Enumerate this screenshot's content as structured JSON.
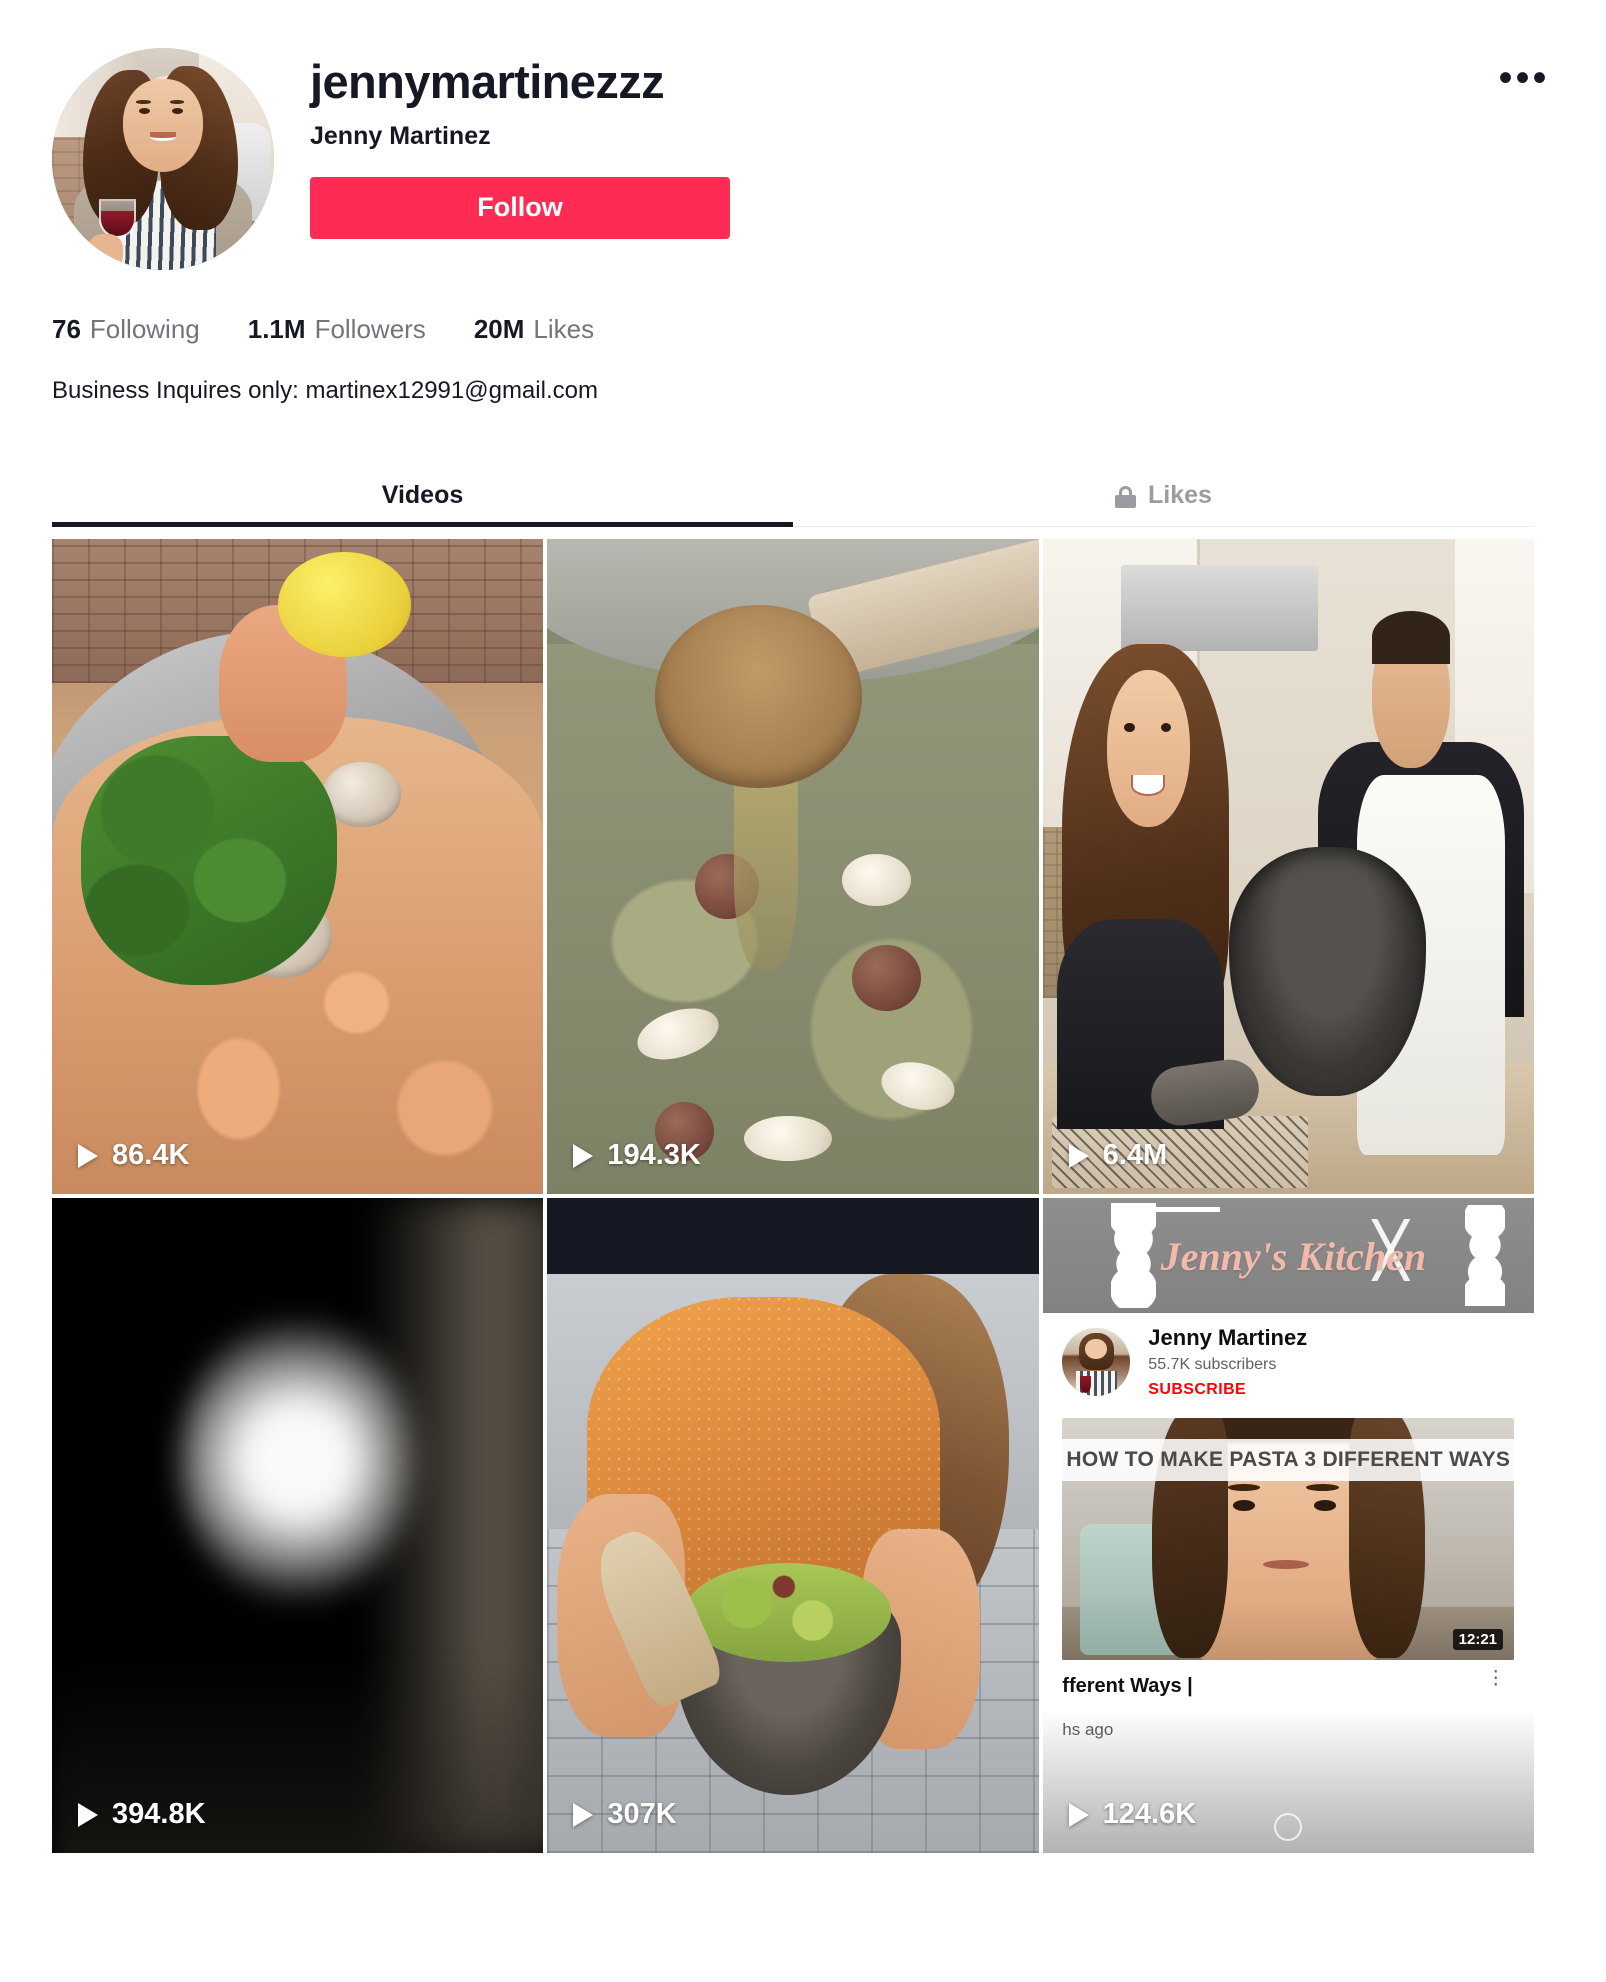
{
  "profile": {
    "username": "jennymartinezzz",
    "display_name": "Jenny Martinez",
    "follow_label": "Follow",
    "more_glyph": "•••",
    "avatar_icon": "profile-photo",
    "stats": [
      {
        "value": "76",
        "label": "Following"
      },
      {
        "value": "1.1M",
        "label": "Followers"
      },
      {
        "value": "20M",
        "label": "Likes"
      }
    ],
    "bio": "Business Inquires only: martinex12991@gmail.com"
  },
  "tabs": [
    {
      "label": "Videos",
      "active": true,
      "locked": false
    },
    {
      "label": "Likes",
      "active": false,
      "locked": true
    }
  ],
  "videos": [
    {
      "views": "86.4K",
      "alt": "shrimp-and-clams-pan-with-lemon"
    },
    {
      "views": "194.3K",
      "alt": "wooden-ladle-pouring-green-broth"
    },
    {
      "views": "6.4M",
      "alt": "couple-holding-molcajete-in-kitchen"
    },
    {
      "views": "394.8K",
      "alt": "bright-overexposed-blur"
    },
    {
      "views": "307K",
      "alt": "woman-in-orange-top-with-guacamole-molcajete"
    },
    {
      "views": "124.6K",
      "alt": "youtube-channel-screen-recording"
    }
  ],
  "youtube_overlay": {
    "banner_text": "Jenny's Kitchen",
    "channel_name": "Jenny Martinez",
    "subscribers": "55.7K subscribers",
    "subscribe_label": "SUBSCRIBE",
    "video_thumb_title": "HOW TO MAKE PASTA 3 DIFFERENT WAYS",
    "duration": "12:21",
    "video_title": "fferent Ways |",
    "video_meta": "hs ago",
    "kebab_glyph": "⋮"
  },
  "colors": {
    "accent": "#fe2c55",
    "text_primary": "#161823",
    "text_secondary": "#74747c",
    "tab_inactive": "#9b9ba4",
    "youtube_red": "#ff0000"
  }
}
